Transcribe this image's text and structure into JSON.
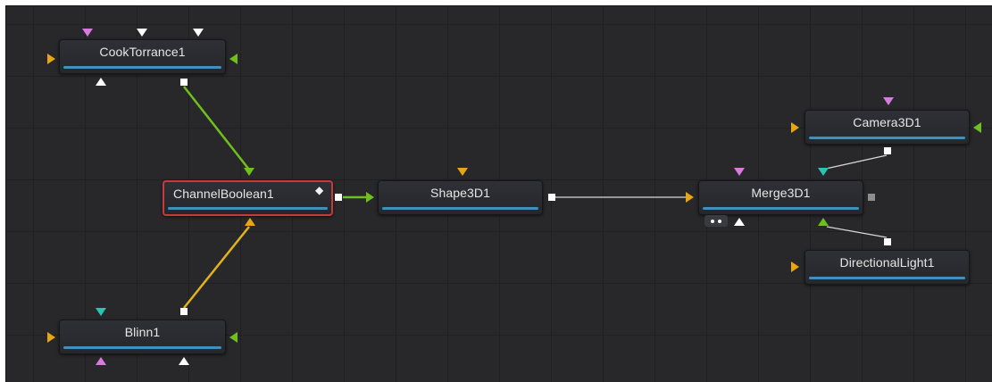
{
  "colors": {
    "background": "#28282b",
    "node_bar": "#3f8fbf",
    "orange": "#e6a712",
    "green": "#6fbf1e",
    "pink": "#d77cde",
    "white": "#ffffff",
    "teal": "#2cc3b3",
    "selection": "#c73a3a"
  },
  "nodes": {
    "cooktorrance": {
      "label": "CookTorrance1"
    },
    "channelboolean": {
      "label": "ChannelBoolean1",
      "selected": true
    },
    "blinn": {
      "label": "Blinn1"
    },
    "shape3d": {
      "label": "Shape3D1"
    },
    "merge3d": {
      "label": "Merge3D1"
    },
    "camera3d": {
      "label": "Camera3D1"
    },
    "directionallight": {
      "label": "DirectionalLight1"
    }
  },
  "connections": [
    {
      "from": "CookTorrance1",
      "to": "ChannelBoolean1",
      "color": "green"
    },
    {
      "from": "Blinn1",
      "to": "ChannelBoolean1",
      "color": "yellow"
    },
    {
      "from": "ChannelBoolean1",
      "to": "Shape3D1",
      "color": "green"
    },
    {
      "from": "Shape3D1",
      "to": "Merge3D1",
      "color": "white"
    },
    {
      "from": "Camera3D1",
      "to": "Merge3D1",
      "color": "white"
    },
    {
      "from": "DirectionalLight1",
      "to": "Merge3D1",
      "color": "white"
    }
  ]
}
